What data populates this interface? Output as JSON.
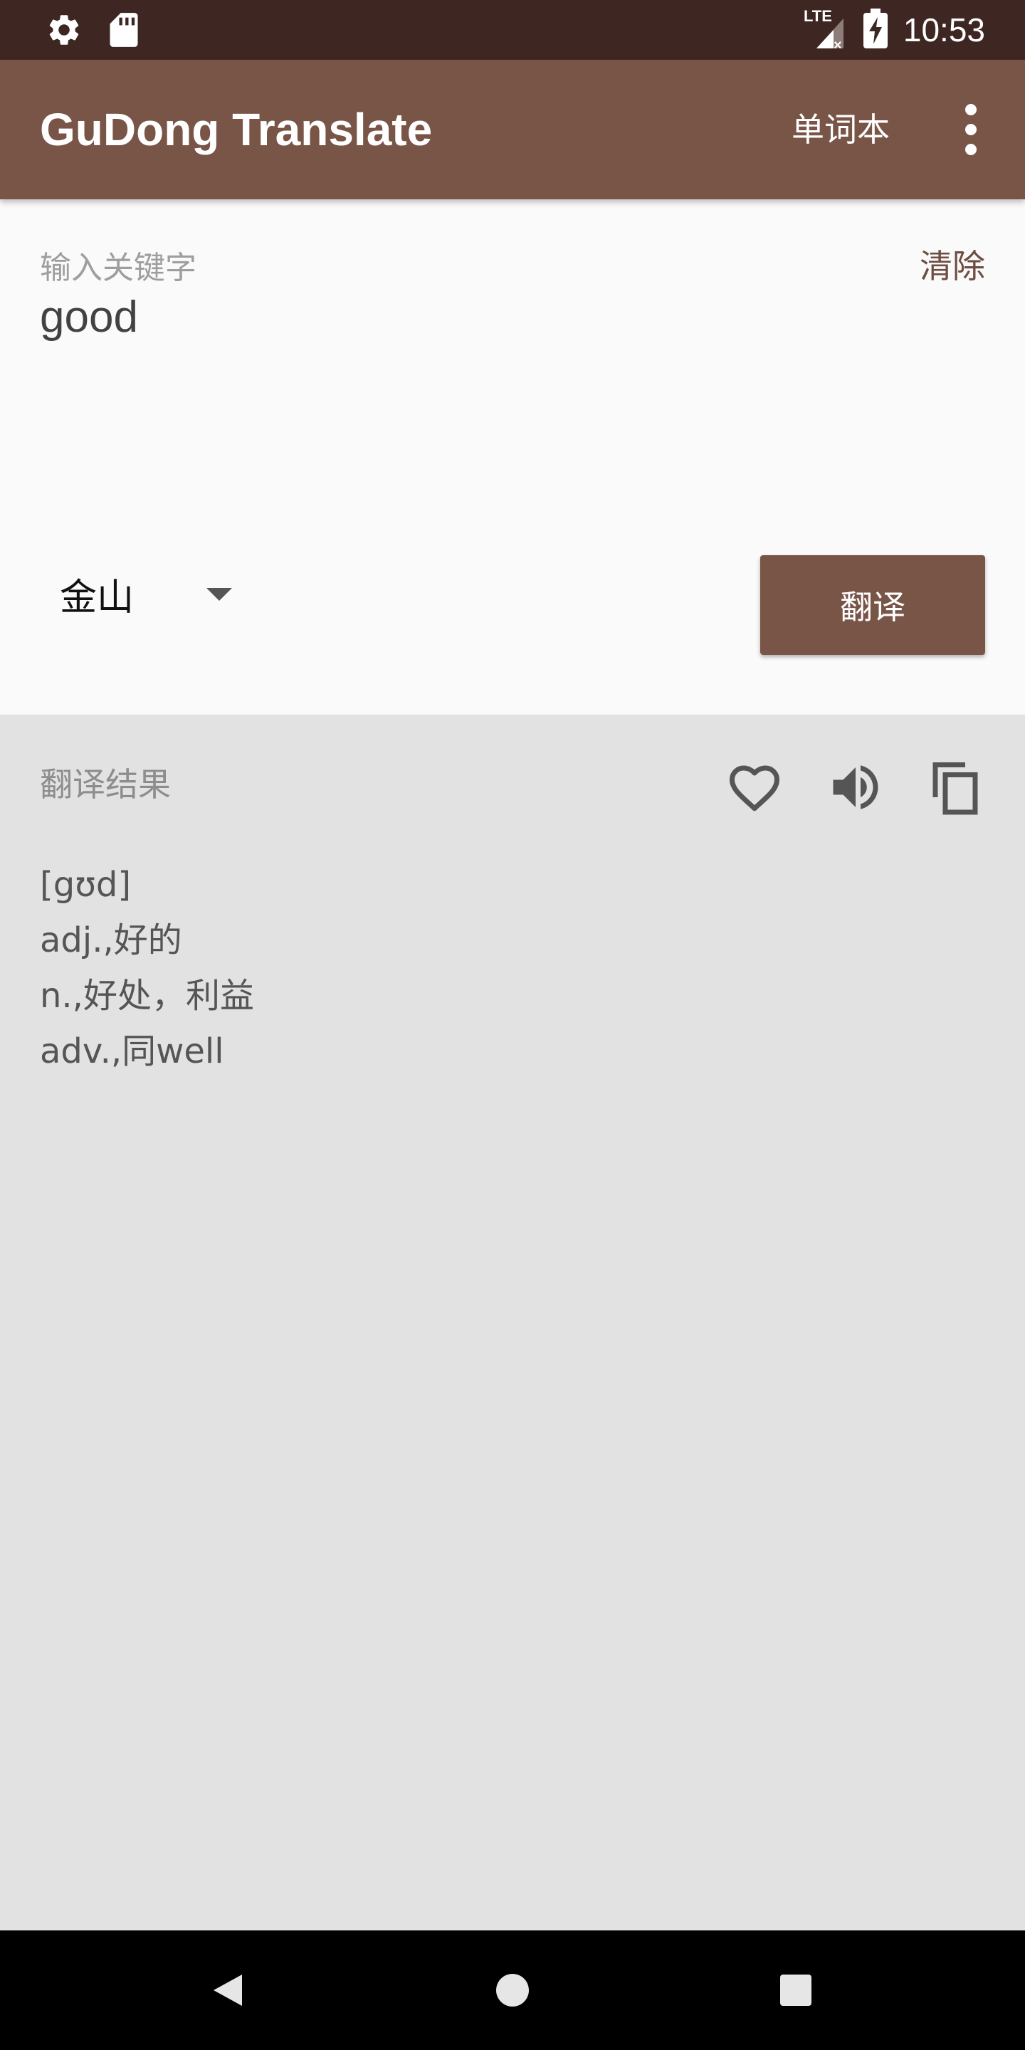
{
  "status_bar": {
    "time": "10:53",
    "network_label": "LTE",
    "left_icons": [
      "settings-icon",
      "sd-card-icon"
    ],
    "right_icons": [
      "lte-signal-icon",
      "battery-charging-icon"
    ]
  },
  "app_bar": {
    "title": "GuDong Translate",
    "vocab_label": "单词本",
    "overflow_icon": "more-vert-icon"
  },
  "input": {
    "hint": "输入关键字",
    "value": "good",
    "clear_label": "清除",
    "engine": "金山",
    "translate_label": "翻译"
  },
  "result": {
    "title": "翻译结果",
    "actions": [
      "favorite-icon",
      "volume-icon",
      "copy-icon"
    ],
    "lines": [
      "[gʊd]",
      "adj.,好的",
      "n.,好处，利益",
      "adv.,同well"
    ]
  },
  "nav_bar": {
    "buttons": [
      "back",
      "home",
      "recents"
    ]
  },
  "colors": {
    "status_bar": "#3e2723",
    "app_bar": "#795548",
    "accent": "#6d4c41",
    "input_background": "#fafafa",
    "result_background": "#e2e2e2",
    "nav_bar": "#000000"
  }
}
